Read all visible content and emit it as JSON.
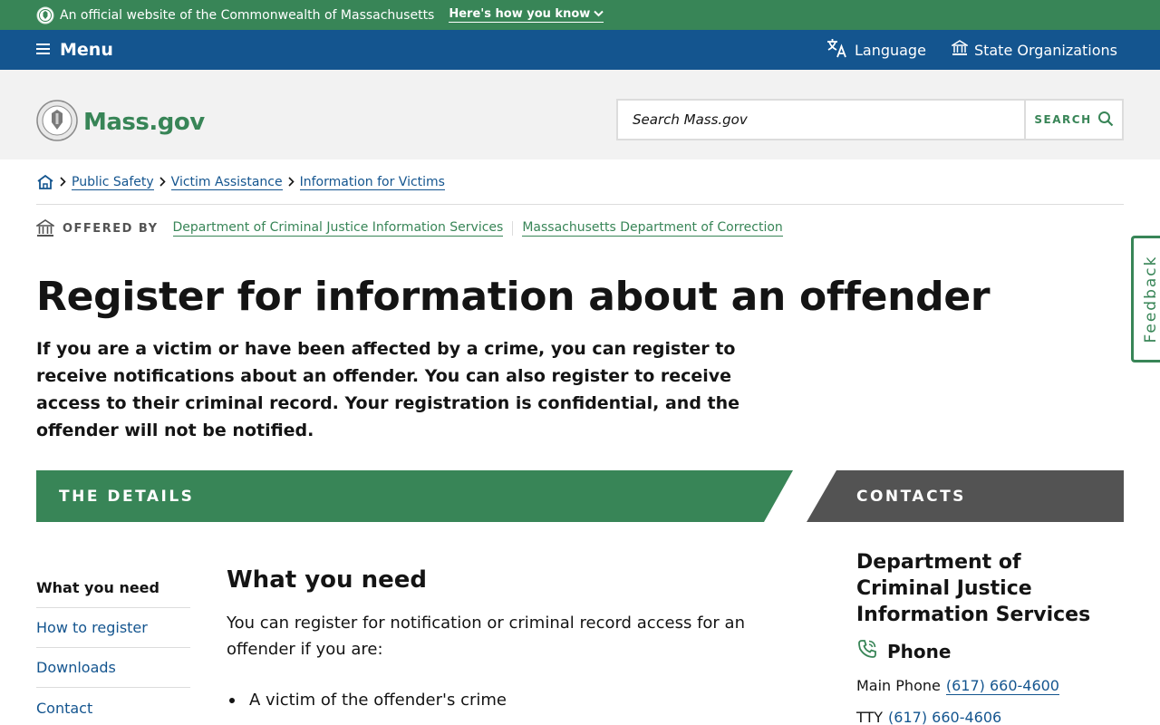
{
  "banner": {
    "text": "An official website of the Commonwealth of Massachusetts",
    "how_link": "Here's how you know"
  },
  "utility_nav": {
    "menu_label": "Menu",
    "language_label": "Language",
    "orgs_label": "State Organizations"
  },
  "header": {
    "logo_text": "Mass.gov",
    "search_placeholder": "Search Mass.gov",
    "search_button": "SEARCH"
  },
  "breadcrumb": [
    "Public Safety",
    "Victim Assistance",
    "Information for Victims"
  ],
  "offered_by": {
    "label": "OFFERED BY",
    "orgs": [
      "Department of Criminal Justice Information Services",
      "Massachusetts Department of Correction"
    ]
  },
  "page": {
    "title": "Register for information about an offender",
    "lede": "If you are a victim or have been affected by a crime, you can register to receive notifications about an offender. You can also register to receive access to their criminal record. Your registration is confidential, and the offender will not be notified."
  },
  "sections": {
    "details": "THE DETAILS",
    "contacts": "CONTACTS"
  },
  "side_nav": [
    "What you need",
    "How to register",
    "Downloads",
    "Contact"
  ],
  "main": {
    "heading": "What you need",
    "intro": "You can register for notification or criminal record access for an offender if you are:",
    "bullets": [
      "A victim of the offender's crime"
    ]
  },
  "contacts": {
    "org_name": "Department of Criminal Justice Information Services",
    "phone_heading": "Phone",
    "main_label": "Main Phone",
    "main_number": "(617) 660-4600",
    "tty_label": "TTY",
    "tty_number": "(617) 660-4606"
  },
  "feedback_label": "Feedback",
  "colors": {
    "green": "#388557",
    "blue": "#14558f",
    "dark_gray": "#535353",
    "light_gray": "#f2f2f2"
  }
}
